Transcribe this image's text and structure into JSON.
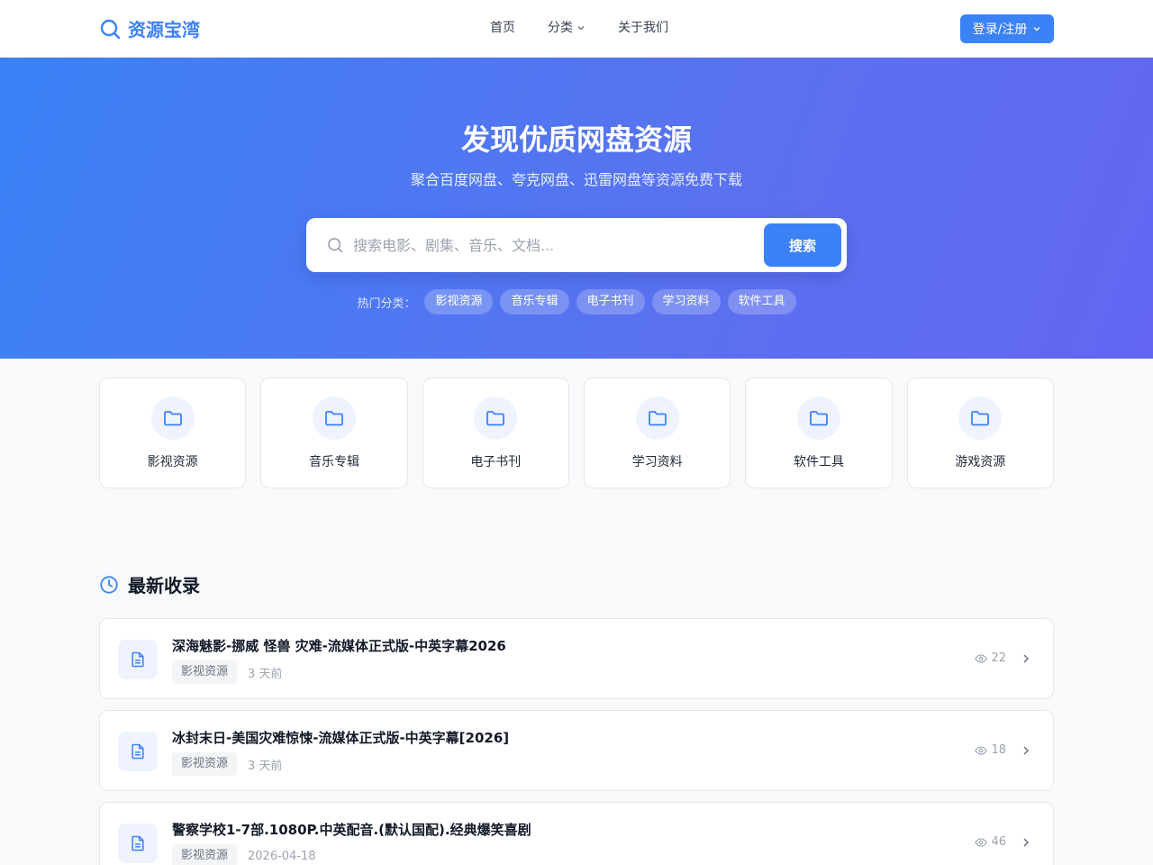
{
  "header": {
    "logo_text": "资源宝湾",
    "nav": [
      {
        "label": "首页"
      },
      {
        "label": "分类"
      },
      {
        "label": "关于我们"
      }
    ],
    "login_label": "登录/注册"
  },
  "hero": {
    "title": "发现优质网盘资源",
    "subtitle": "聚合百度网盘、夸克网盘、迅雷网盘等资源免费下载",
    "search_placeholder": "搜索电影、剧集、音乐、文档...",
    "search_button": "搜索",
    "hot_label": "热门分类：",
    "hot_tags": [
      "影视资源",
      "音乐专辑",
      "电子书刊",
      "学习资料",
      "软件工具"
    ]
  },
  "categories": [
    {
      "label": "影视资源"
    },
    {
      "label": "音乐专辑"
    },
    {
      "label": "电子书刊"
    },
    {
      "label": "学习资料"
    },
    {
      "label": "软件工具"
    },
    {
      "label": "游戏资源"
    }
  ],
  "latest": {
    "title": "最新收录",
    "items": [
      {
        "title": "深海魅影-挪威 怪兽 灾难-流媒体正式版-中英字幕2026",
        "tag": "影视资源",
        "date": "3 天前",
        "views": "22"
      },
      {
        "title": "冰封末日-美国灾难惊悚-流媒体正式版-中英字幕[2026]",
        "tag": "影视资源",
        "date": "3 天前",
        "views": "18"
      },
      {
        "title": "警察学校1-7部.1080P.中英配音.(默认国配).经典爆笑喜剧",
        "tag": "影视资源",
        "date": "2026-04-18",
        "views": "46"
      }
    ]
  },
  "colors": {
    "accent": "#3b82f6",
    "hero_start": "#3b82f6",
    "hero_end": "#6366f1"
  }
}
